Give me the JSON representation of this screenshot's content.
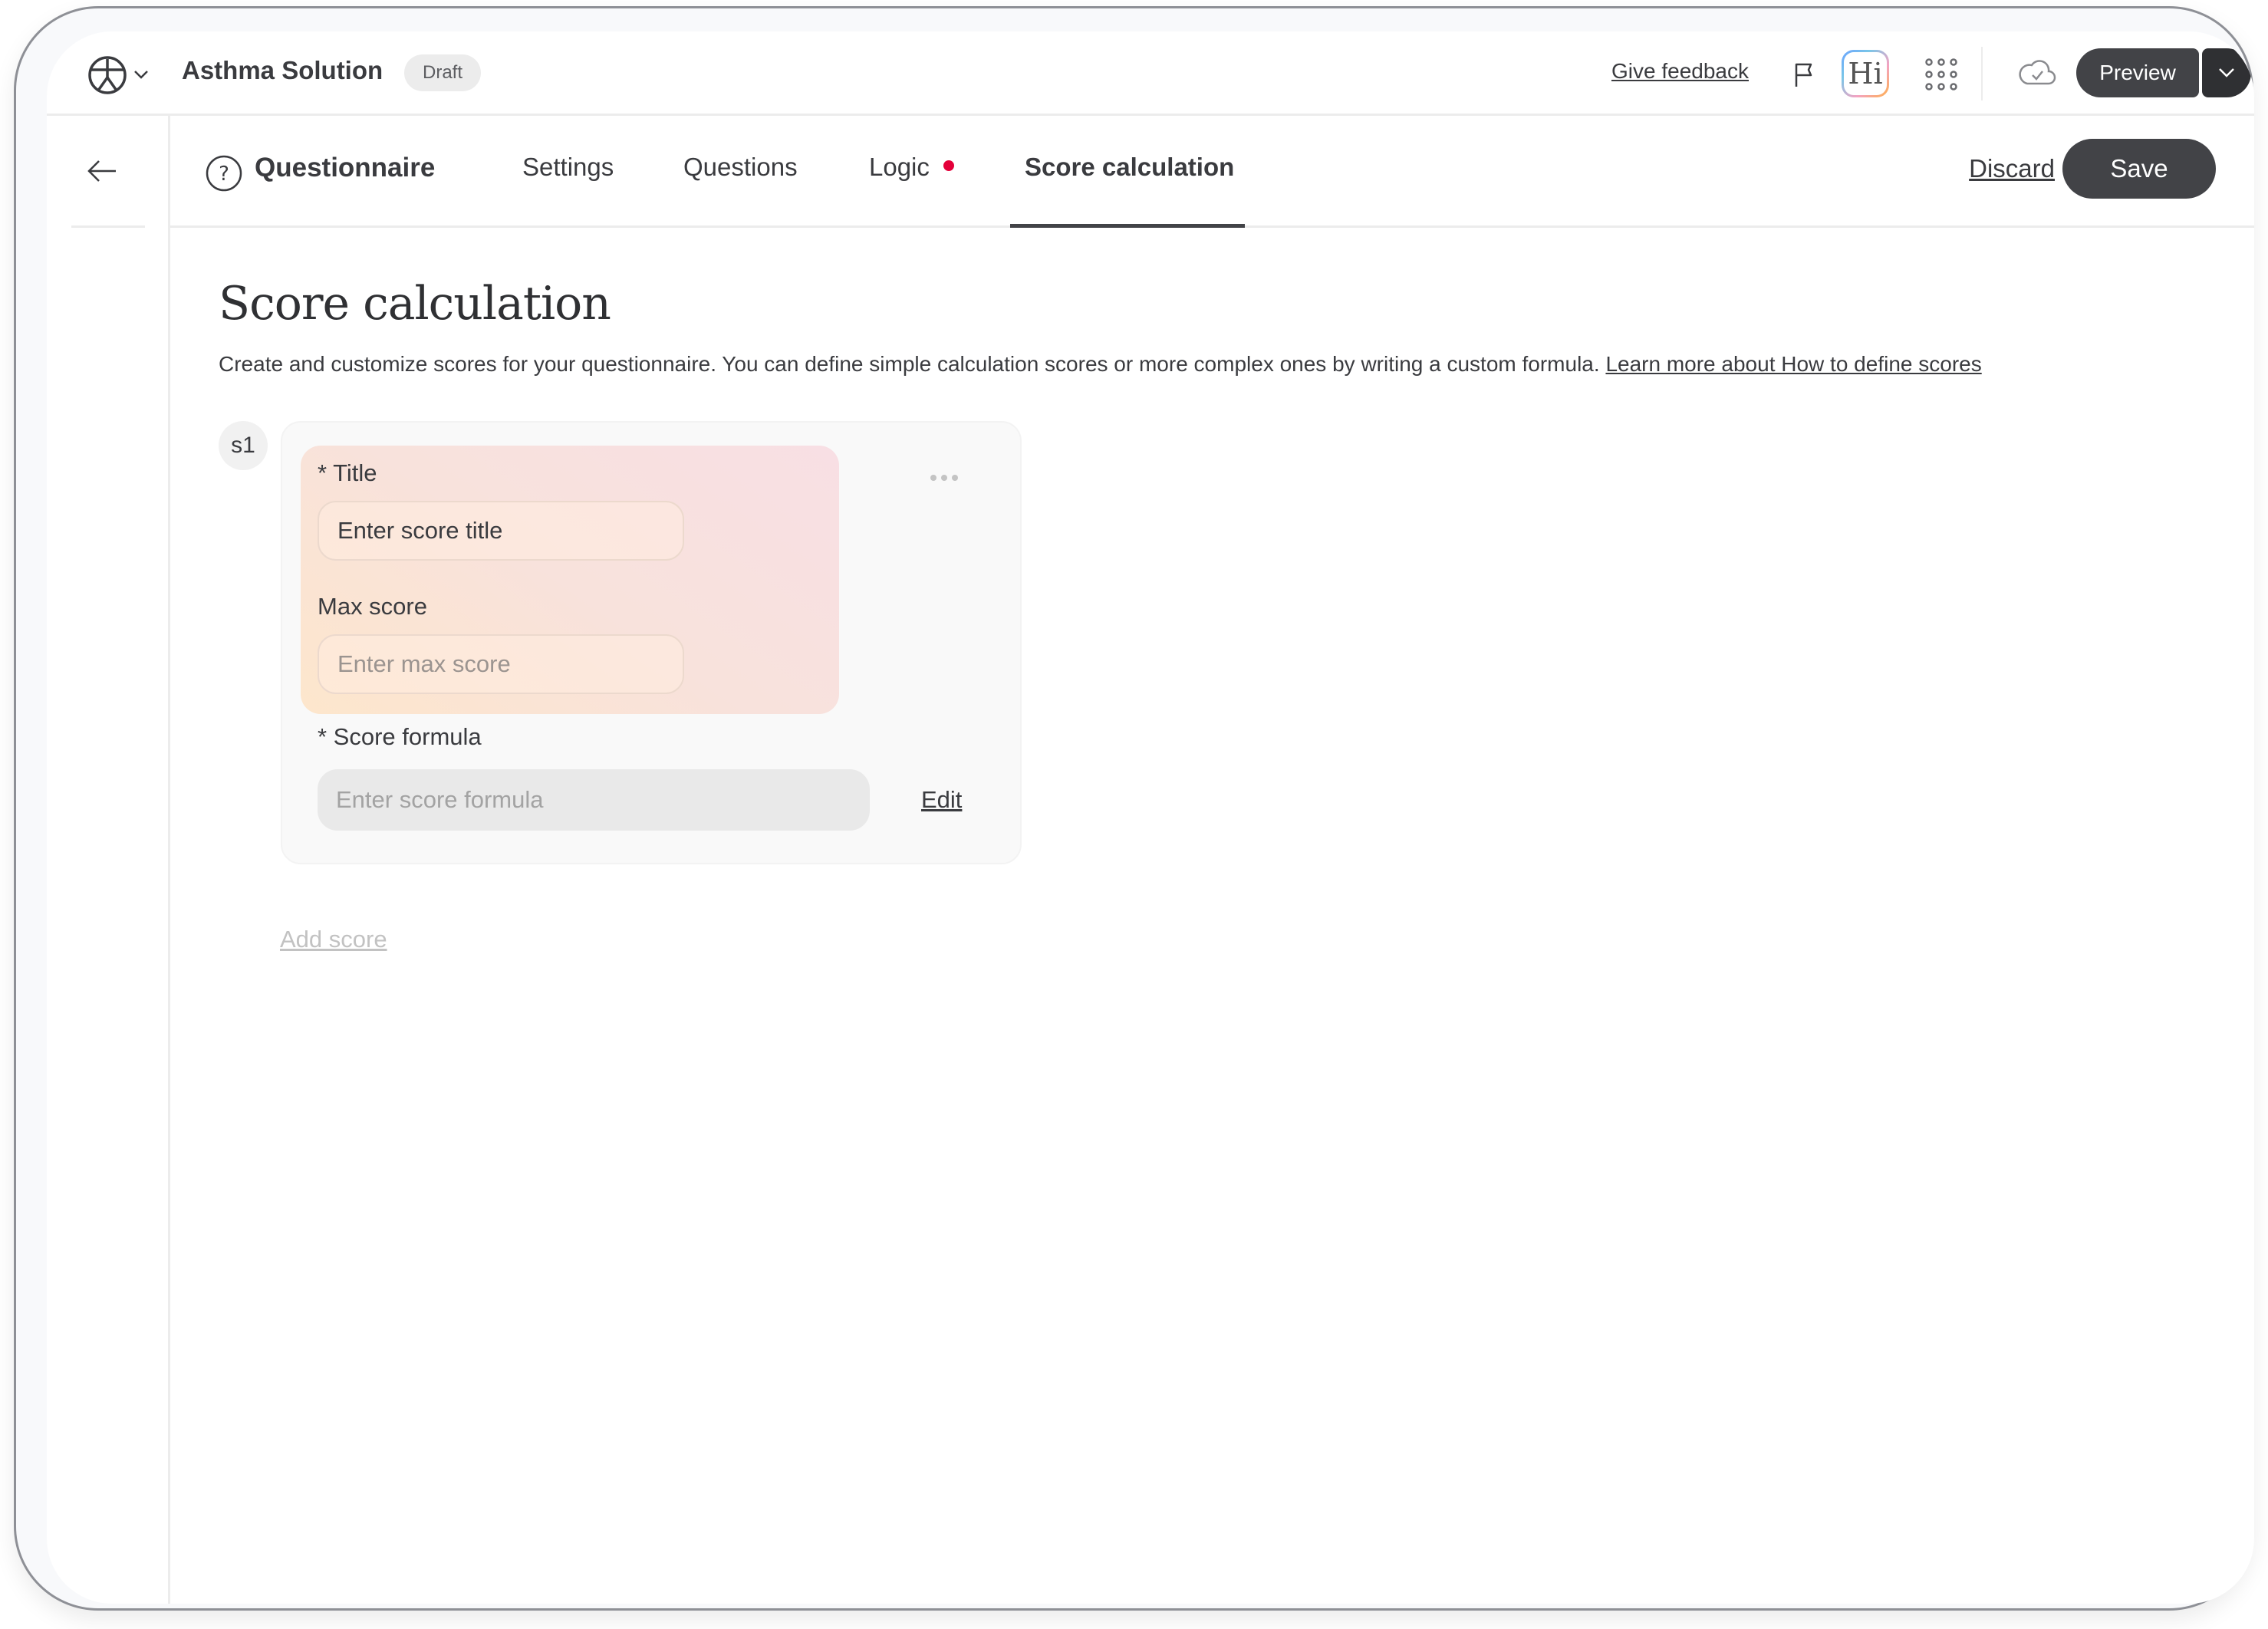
{
  "header": {
    "app_title": "Asthma Solution",
    "status_badge": "Draft",
    "feedback_label": "Give feedback",
    "assistant_label": "Hi",
    "preview_label": "Preview"
  },
  "nav": {
    "section_title": "Questionnaire",
    "tabs": [
      {
        "label": "Settings",
        "active": false
      },
      {
        "label": "Questions",
        "active": false
      },
      {
        "label": "Logic",
        "active": false,
        "has_alert_dot": true
      },
      {
        "label": "Score calculation",
        "active": true
      }
    ],
    "discard_label": "Discard",
    "save_label": "Save",
    "alert_dot_color": "#e4003a"
  },
  "page": {
    "title": "Score calculation",
    "description": "Create and customize scores for your questionnaire. You can define simple calculation scores or more complex ones by writing a custom formula.",
    "learn_more_link": "Learn more about How to define scores"
  },
  "scores": [
    {
      "id_badge": "s1",
      "title_label": "* Title",
      "title_placeholder": "Enter score title",
      "max_score_label": "Max score",
      "max_score_placeholder": "Enter max score",
      "formula_label": "* Score formula",
      "formula_placeholder": "Enter score formula",
      "edit_label": "Edit"
    }
  ],
  "add_score_label": "Add score",
  "colors": {
    "primary_button": "#424347",
    "accent_alert": "#e4003a"
  }
}
